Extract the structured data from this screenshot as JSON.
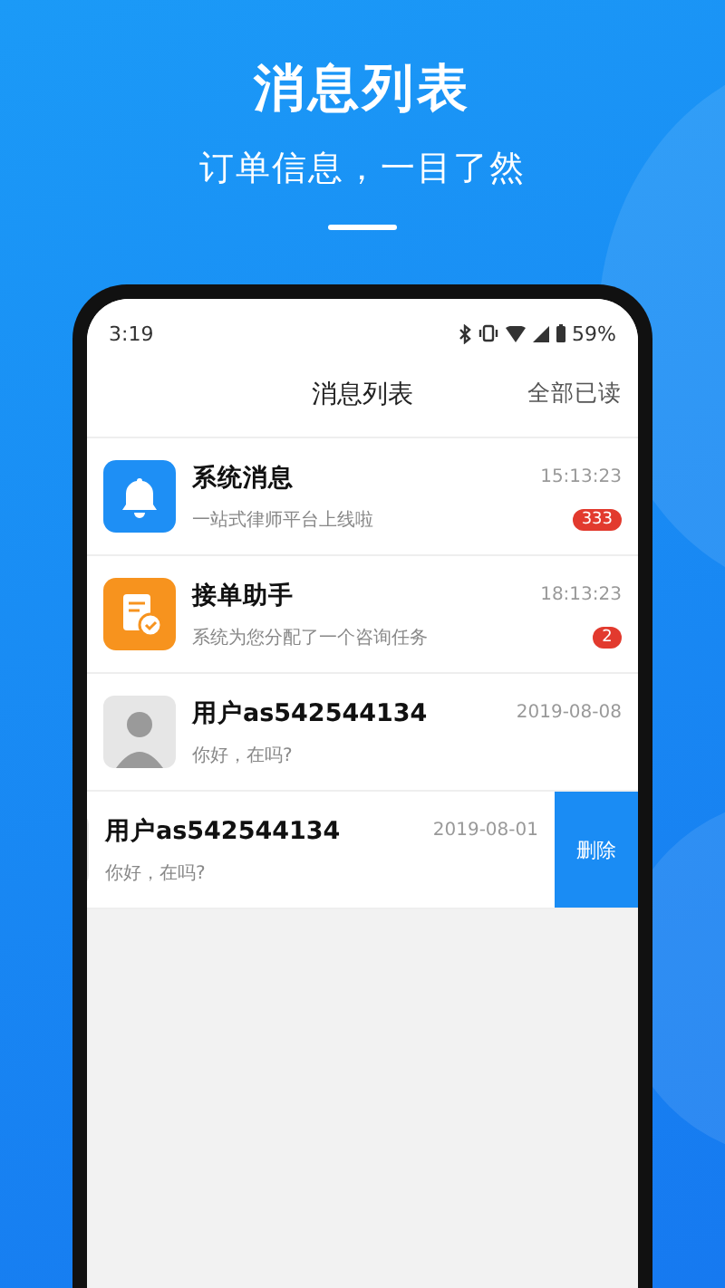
{
  "banner": {
    "title": "消息列表",
    "subtitle": "订单信息，一目了然"
  },
  "status_bar": {
    "time": "3:19",
    "battery": "59%"
  },
  "nav": {
    "title": "消息列表",
    "action": "全部已读"
  },
  "messages": [
    {
      "kind": "bell",
      "title": "系统消息",
      "preview": "一站式律师平台上线啦",
      "time": "15:13:23",
      "badge": "333",
      "swiped": false
    },
    {
      "kind": "clipboard",
      "title": "接单助手",
      "preview": "系统为您分配了一个咨询任务",
      "time": "18:13:23",
      "badge": "2",
      "swiped": false
    },
    {
      "kind": "avatar",
      "title": "用户as542544134",
      "preview": "你好，在吗?",
      "time": "2019-08-08",
      "swiped": false
    },
    {
      "kind": "avatar",
      "title": "用户as542544134",
      "preview": "你好，在吗?",
      "time": "2019-08-01",
      "swiped": true,
      "action": "删除"
    }
  ]
}
